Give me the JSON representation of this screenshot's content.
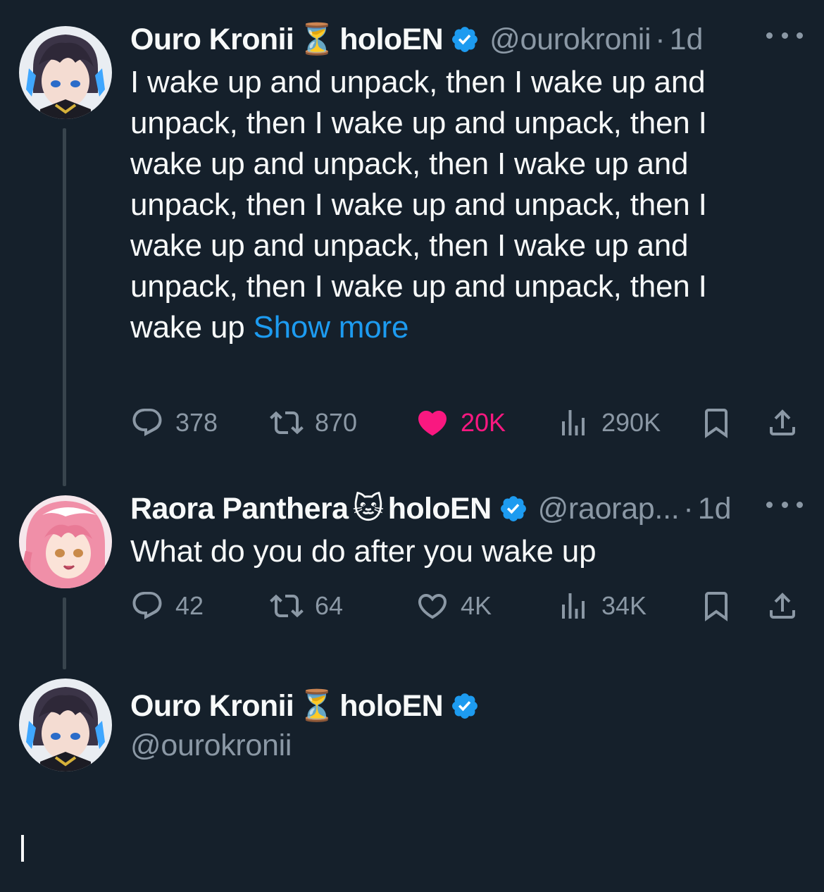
{
  "tweets": [
    {
      "name": "Ouro Kronii",
      "emoji": "⏳",
      "group": "holoEN",
      "handle": "@ourokronii",
      "time": "1d",
      "text": "I wake up and unpack, then I wake up and unpack, then I wake up and unpack, then I wake up and unpack, then I wake up and unpack, then I wake up and unpack, then I wake up and unpack, then I wake up and unpack, then I wake up and unpack, then I wake up ",
      "show_more": "Show more",
      "replies": "378",
      "reposts": "870",
      "likes": "20K",
      "views": "290K"
    },
    {
      "name": "Raora Panthera",
      "emoji": "🐱",
      "group": "holoEN",
      "handle": "@raorap...",
      "time": "1d",
      "text": "What do you do after you wake up",
      "replies": "42",
      "reposts": "64",
      "likes": "4K",
      "views": "34K"
    }
  ],
  "composer": {
    "name": "Ouro Kronii",
    "emoji": "⏳",
    "group": "holoEN",
    "handle": "@ourokronii"
  },
  "separator": "·",
  "colors": {
    "background": "#15202b",
    "accent": "#1d9bf0",
    "like": "#f91880",
    "muted": "#8b98a5"
  }
}
